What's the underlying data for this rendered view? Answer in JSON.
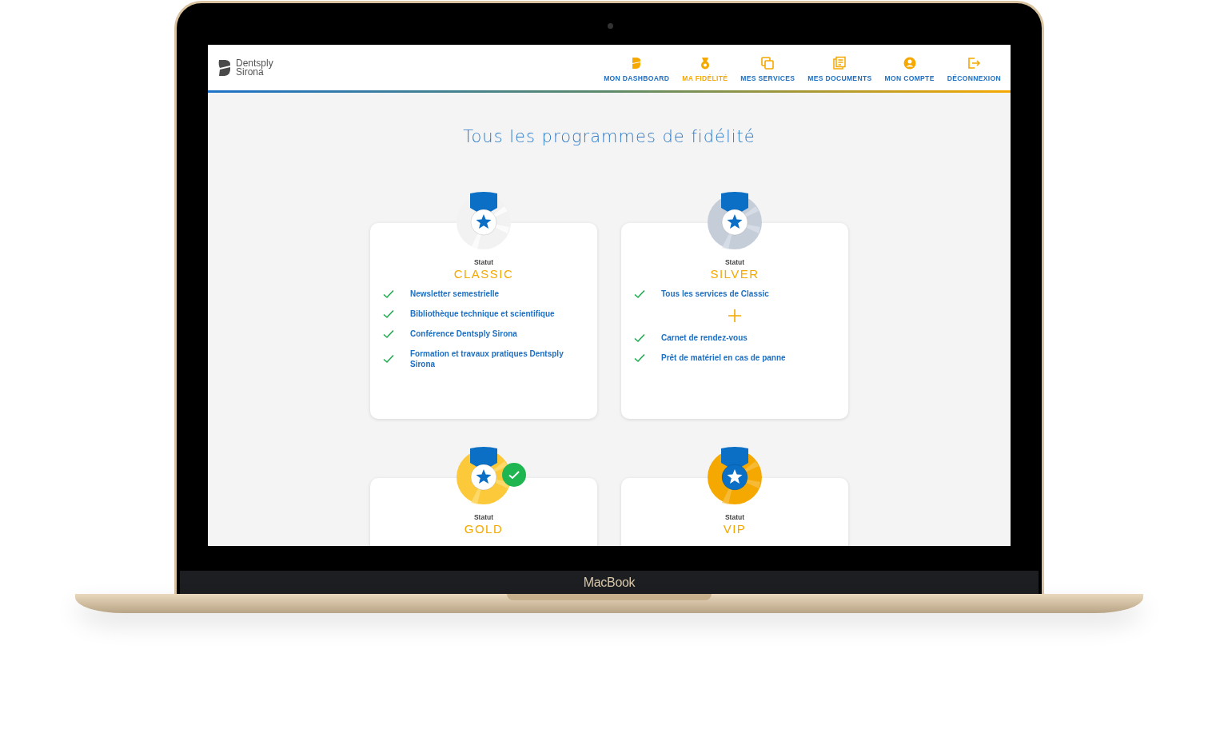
{
  "device": {
    "label": "MacBook"
  },
  "header": {
    "logo": [
      "Dentsply",
      "Sirona"
    ],
    "nav": [
      {
        "label": "MON DASHBOARD",
        "selected": false
      },
      {
        "label": "MA FIDÉLITÉ",
        "selected": true
      },
      {
        "label": "MES SERVICES",
        "selected": false
      },
      {
        "label": "MES DOCUMENTS",
        "selected": false
      },
      {
        "label": "MON COMPTE",
        "selected": false
      },
      {
        "label": "DÉCONNEXION",
        "selected": false
      }
    ]
  },
  "title": "Tous les programmes de fidélité",
  "programs": [
    {
      "status_label": "Statut",
      "name": "CLASSIC",
      "kind": "classic",
      "achieved": false,
      "features": [
        {
          "kind": "check",
          "text": "Newsletter semestrielle"
        },
        {
          "kind": "check",
          "text": "Bibliothèque technique et scientifique"
        },
        {
          "kind": "check",
          "text": "Conférence Dentsply Sirona"
        },
        {
          "kind": "check",
          "text": "Formation et travaux pratiques Dentsply Sirona"
        }
      ]
    },
    {
      "status_label": "Statut",
      "name": "SILVER",
      "kind": "silver",
      "achieved": false,
      "features": [
        {
          "kind": "check",
          "text": "Tous les services de Classic"
        },
        {
          "kind": "plus"
        },
        {
          "kind": "check",
          "text": "Carnet de rendez-vous"
        },
        {
          "kind": "check",
          "text": "Prêt de matériel en cas de panne"
        }
      ]
    },
    {
      "status_label": "Statut",
      "name": "GOLD",
      "kind": "gold",
      "achieved": true
    },
    {
      "status_label": "Statut",
      "name": "VIP",
      "kind": "vip",
      "achieved": false
    }
  ]
}
